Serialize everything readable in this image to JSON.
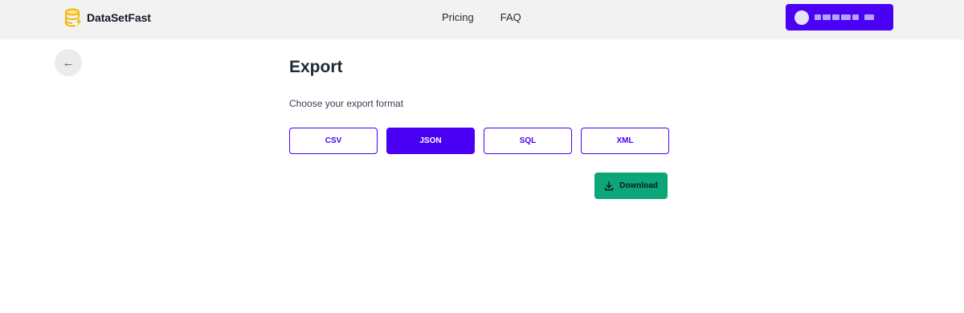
{
  "header": {
    "brand": "DataSetFast",
    "nav": [
      {
        "label": "Pricing"
      },
      {
        "label": "FAQ"
      }
    ],
    "brand_color": "#4a00f5"
  },
  "back": {
    "glyph": "←"
  },
  "page": {
    "title": "Export",
    "subtitle": "Choose your export format"
  },
  "formats": {
    "options": [
      "CSV",
      "JSON",
      "SQL",
      "XML"
    ],
    "selected": "JSON"
  },
  "download": {
    "label": "Download",
    "color": "#0ca678"
  },
  "icons": {
    "logo": "database-icon",
    "download": "download-icon",
    "back": "arrow-left-icon"
  }
}
